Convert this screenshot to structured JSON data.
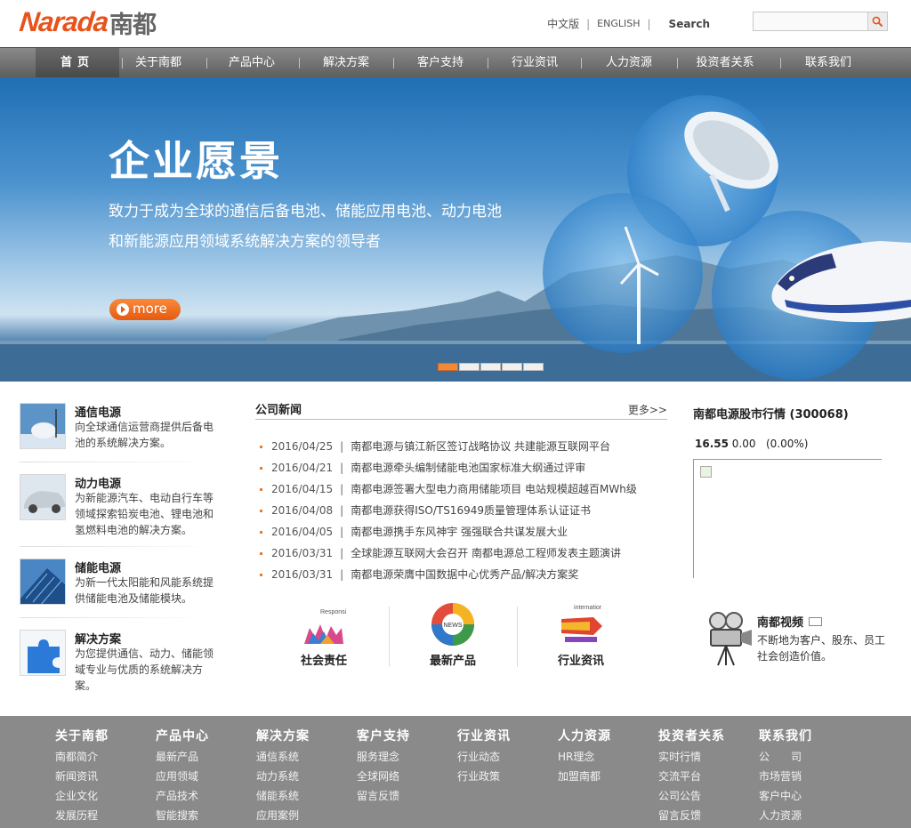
{
  "header": {
    "logo_latin": "Narada",
    "logo_cn": "南都",
    "lang_cn": "中文版",
    "lang_en": "ENGLISH",
    "search_label": "Search",
    "search_value": ""
  },
  "nav": {
    "items": [
      "首页",
      "关于南都",
      "产品中心",
      "解决方案",
      "客户支持",
      "行业资讯",
      "人力资源",
      "投资者关系",
      "联系我们"
    ]
  },
  "banner": {
    "title": "企业愿景",
    "line1": "致力于成为全球的通信后备电池、储能应用电池、动力电池",
    "line2": "和新能源应用领域系统解决方案的领导者",
    "more": "more",
    "slide_count": 5,
    "active_slide": 1
  },
  "products": [
    {
      "title": "通信电源",
      "desc": "向全球通信运营商提供后备电池的系统解决方案。"
    },
    {
      "title": "动力电源",
      "desc": "为新能源汽车、电动自行车等领域探索铅炭电池、锂电池和氢燃料电池的解决方案。"
    },
    {
      "title": "储能电源",
      "desc": "为新一代太阳能和风能系统提供储能电池及储能模块。"
    },
    {
      "title": "解决方案",
      "desc": "为您提供通信、动力、储能领域专业与优质的系统解决方案。"
    }
  ],
  "news": {
    "title": "公司新闻",
    "more": "更多>>",
    "items": [
      {
        "date": "2016/04/25",
        "title": "南都电源与镇江新区签订战略协议 共建能源互联网平台"
      },
      {
        "date": "2016/04/21",
        "title": "南都电源牵头编制储能电池国家标准大纲通过评审"
      },
      {
        "date": "2016/04/15",
        "title": "南都电源签署大型电力商用储能项目 电站规模超越百MWh级"
      },
      {
        "date": "2016/04/08",
        "title": "南都电源获得ISO/TS16949质量管理体系认证证书"
      },
      {
        "date": "2016/04/05",
        "title": "南都电源携手东风神宇 强强联合共谋发展大业"
      },
      {
        "date": "2016/03/31",
        "title": "全球能源互联网大会召开 南都电源总工程师发表主题演讲"
      },
      {
        "date": "2016/03/31",
        "title": "南都电源荣膺中国数据中心优秀产品/解决方案奖"
      }
    ]
  },
  "tiles": [
    {
      "label": "社会责任",
      "img_text": "Responsi"
    },
    {
      "label": "最新产品",
      "img_text": "NEWS"
    },
    {
      "label": "行业资讯",
      "img_text": "internatior"
    }
  ],
  "stock": {
    "title": "南都电源股市行情 (300068)",
    "price": "16.55",
    "change": "0.00",
    "percent": "(0.00%)"
  },
  "video": {
    "title": "南都视频",
    "desc": "不断地为客户、股东、员工社会创造价值。"
  },
  "footer": {
    "columns": [
      {
        "head": "关于南都",
        "links": [
          "南都简介",
          "新闻资讯",
          "企业文化",
          "发展历程"
        ]
      },
      {
        "head": "产品中心",
        "links": [
          "最新产品",
          "应用领域",
          "产品技术",
          "智能搜索"
        ]
      },
      {
        "head": "解决方案",
        "links": [
          "通信系统",
          "动力系统",
          "储能系统",
          "应用案例"
        ]
      },
      {
        "head": "客户支持",
        "links": [
          "服务理念",
          "全球网络",
          "留言反馈"
        ]
      },
      {
        "head": "行业资讯",
        "links": [
          "行业动态",
          "行业政策"
        ]
      },
      {
        "head": "人力资源",
        "links": [
          "HR理念",
          "加盟南都"
        ]
      },
      {
        "head": "投资者关系",
        "links": [
          "实时行情",
          "交流平台",
          "公司公告",
          "留言反馈"
        ]
      },
      {
        "head": "联系我们",
        "links": [
          "公　　司",
          "市场营销",
          "客户中心",
          "人力资源"
        ]
      }
    ]
  },
  "colors": {
    "brand_orange": "#e8531c",
    "nav_gray": "#6e6e6e",
    "footer_gray": "#8a8a8a",
    "bullet_orange": "#e87b2c"
  }
}
